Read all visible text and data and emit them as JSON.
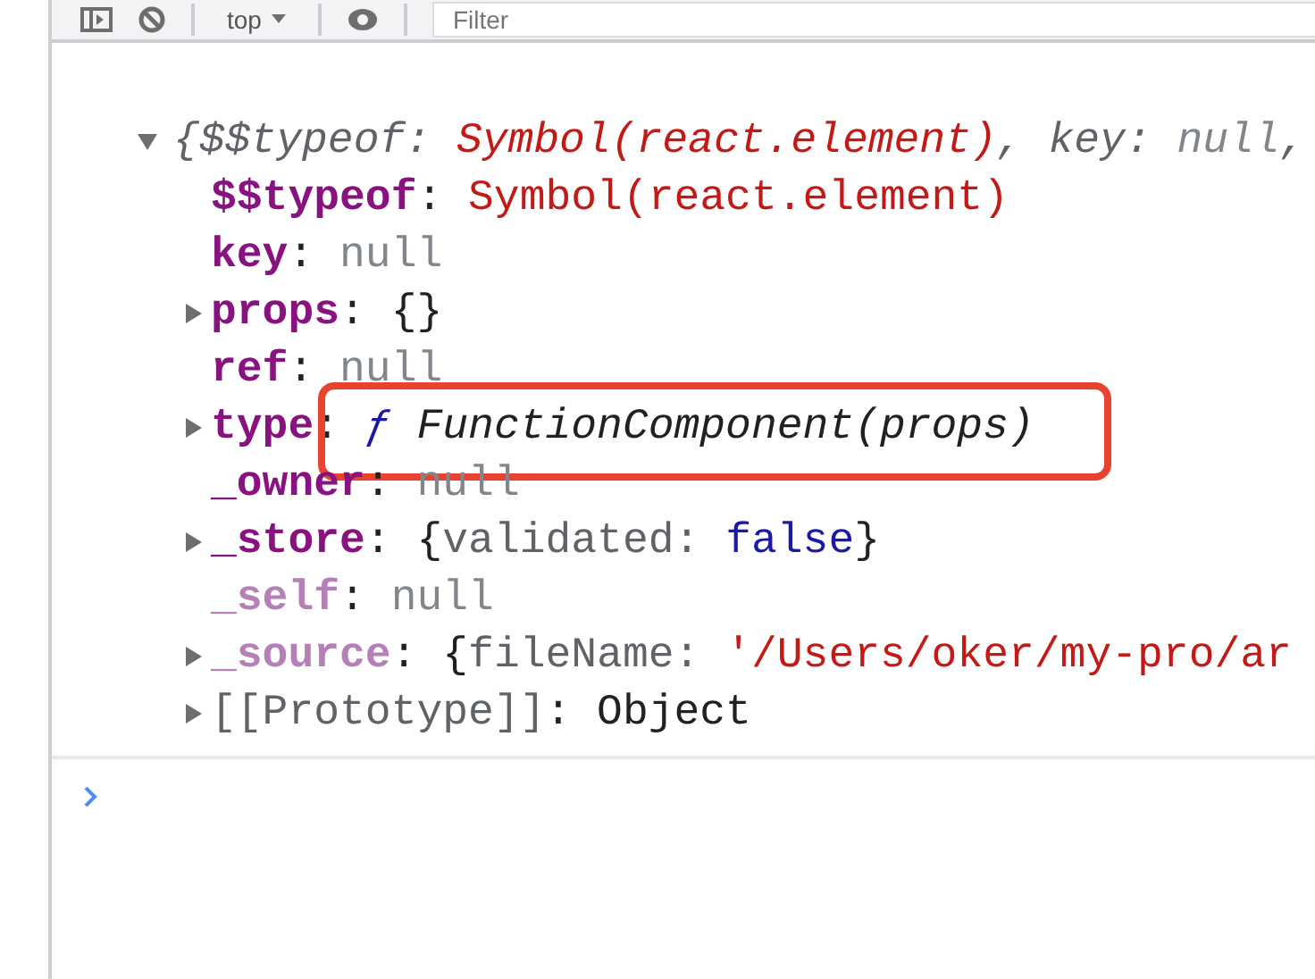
{
  "toolbar": {
    "context": "top",
    "filter": {
      "placeholder": "Filter"
    }
  },
  "rows": [
    {
      "kind": "summary",
      "parts": [
        {
          "text": "{$$typeof: ",
          "kind": "preview"
        },
        {
          "text": "Symbol(react.element)",
          "kind": "string"
        },
        {
          "text": ", key: ",
          "kind": "preview"
        },
        {
          "text": "null",
          "kind": "null"
        },
        {
          "text": ",",
          "kind": "preview"
        }
      ]
    },
    {
      "kind": "leaf",
      "parts": [
        {
          "text": "$$typeof",
          "kind": "key"
        },
        {
          "text": ": ",
          "kind": "punct"
        },
        {
          "text": "Symbol(react.element)",
          "kind": "string"
        }
      ]
    },
    {
      "kind": "leaf",
      "parts": [
        {
          "text": "key",
          "kind": "key"
        },
        {
          "text": ": ",
          "kind": "punct"
        },
        {
          "text": "null",
          "kind": "null"
        }
      ]
    },
    {
      "kind": "collapsed",
      "parts": [
        {
          "text": "props",
          "kind": "key"
        },
        {
          "text": ": {}",
          "kind": "punct"
        }
      ]
    },
    {
      "kind": "leaf",
      "parts": [
        {
          "text": "ref",
          "kind": "key"
        },
        {
          "text": ": ",
          "kind": "punct"
        },
        {
          "text": "null",
          "kind": "null"
        }
      ]
    },
    {
      "kind": "collapsed",
      "highlighted": true,
      "parts": [
        {
          "text": "type",
          "kind": "key"
        },
        {
          "text": ": ",
          "kind": "punct"
        },
        {
          "text": "ƒ",
          "kind": "function"
        },
        {
          "text": " FunctionComponent(props)",
          "kind": "signature"
        }
      ]
    },
    {
      "kind": "leaf",
      "parts": [
        {
          "text": "_owner",
          "kind": "key"
        },
        {
          "text": ": ",
          "kind": "punct"
        },
        {
          "text": "null",
          "kind": "null"
        }
      ]
    },
    {
      "kind": "collapsed",
      "parts": [
        {
          "text": "_store",
          "kind": "key"
        },
        {
          "text": ": {",
          "kind": "punct"
        },
        {
          "text": "validated: ",
          "kind": "preview"
        },
        {
          "text": "false",
          "kind": "boolean"
        },
        {
          "text": "}",
          "kind": "punct"
        }
      ]
    },
    {
      "kind": "leaf",
      "parts": [
        {
          "text": "_self",
          "kind": "hidden_key"
        },
        {
          "text": ": ",
          "kind": "punct"
        },
        {
          "text": "null",
          "kind": "null"
        }
      ]
    },
    {
      "kind": "collapsed",
      "parts": [
        {
          "text": "_source",
          "kind": "hidden_key"
        },
        {
          "text": ": {",
          "kind": "punct"
        },
        {
          "text": "fileName: ",
          "kind": "preview"
        },
        {
          "text": "'/Users/oker/my-pro/ar",
          "kind": "string"
        }
      ]
    },
    {
      "kind": "collapsed",
      "parts": [
        {
          "text": "[[Prototype]]",
          "kind": "internal_key"
        },
        {
          "text": ": Object",
          "kind": "punct"
        }
      ]
    }
  ]
}
